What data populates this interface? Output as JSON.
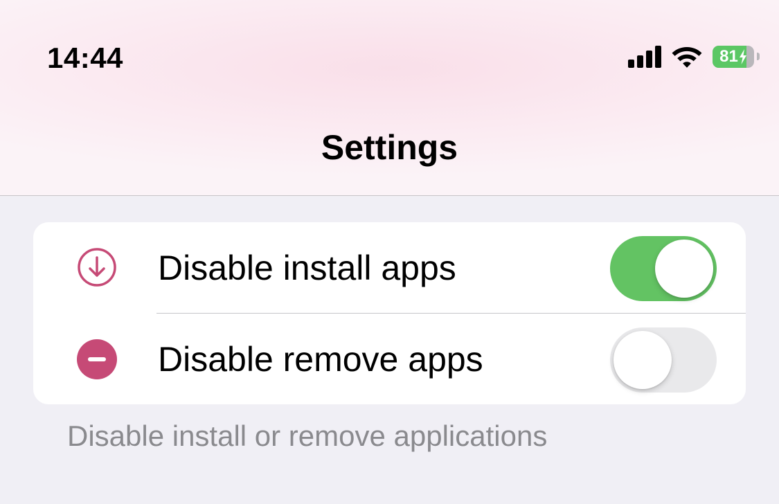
{
  "status_bar": {
    "time": "14:44",
    "battery_percent": "81",
    "battery_level": 0.81,
    "icons": [
      "cellular-signal-icon",
      "wifi-icon",
      "battery-icon",
      "charging-bolt-icon"
    ]
  },
  "nav": {
    "title": "Settings"
  },
  "settings_group": {
    "rows": [
      {
        "label": "Disable install apps",
        "icon": "download-circle-icon",
        "toggle_on": true
      },
      {
        "label": "Disable remove apps",
        "icon": "minus-circle-icon",
        "toggle_on": false
      }
    ],
    "footer": "Disable install or remove applications"
  },
  "colors": {
    "accent_pink": "#c64a76",
    "toggle_on": "#63c363",
    "toggle_off": "#e9e9eb",
    "battery_green": "#5bc764",
    "background": "#f0eff5",
    "footer_text": "#8a8a8e"
  }
}
